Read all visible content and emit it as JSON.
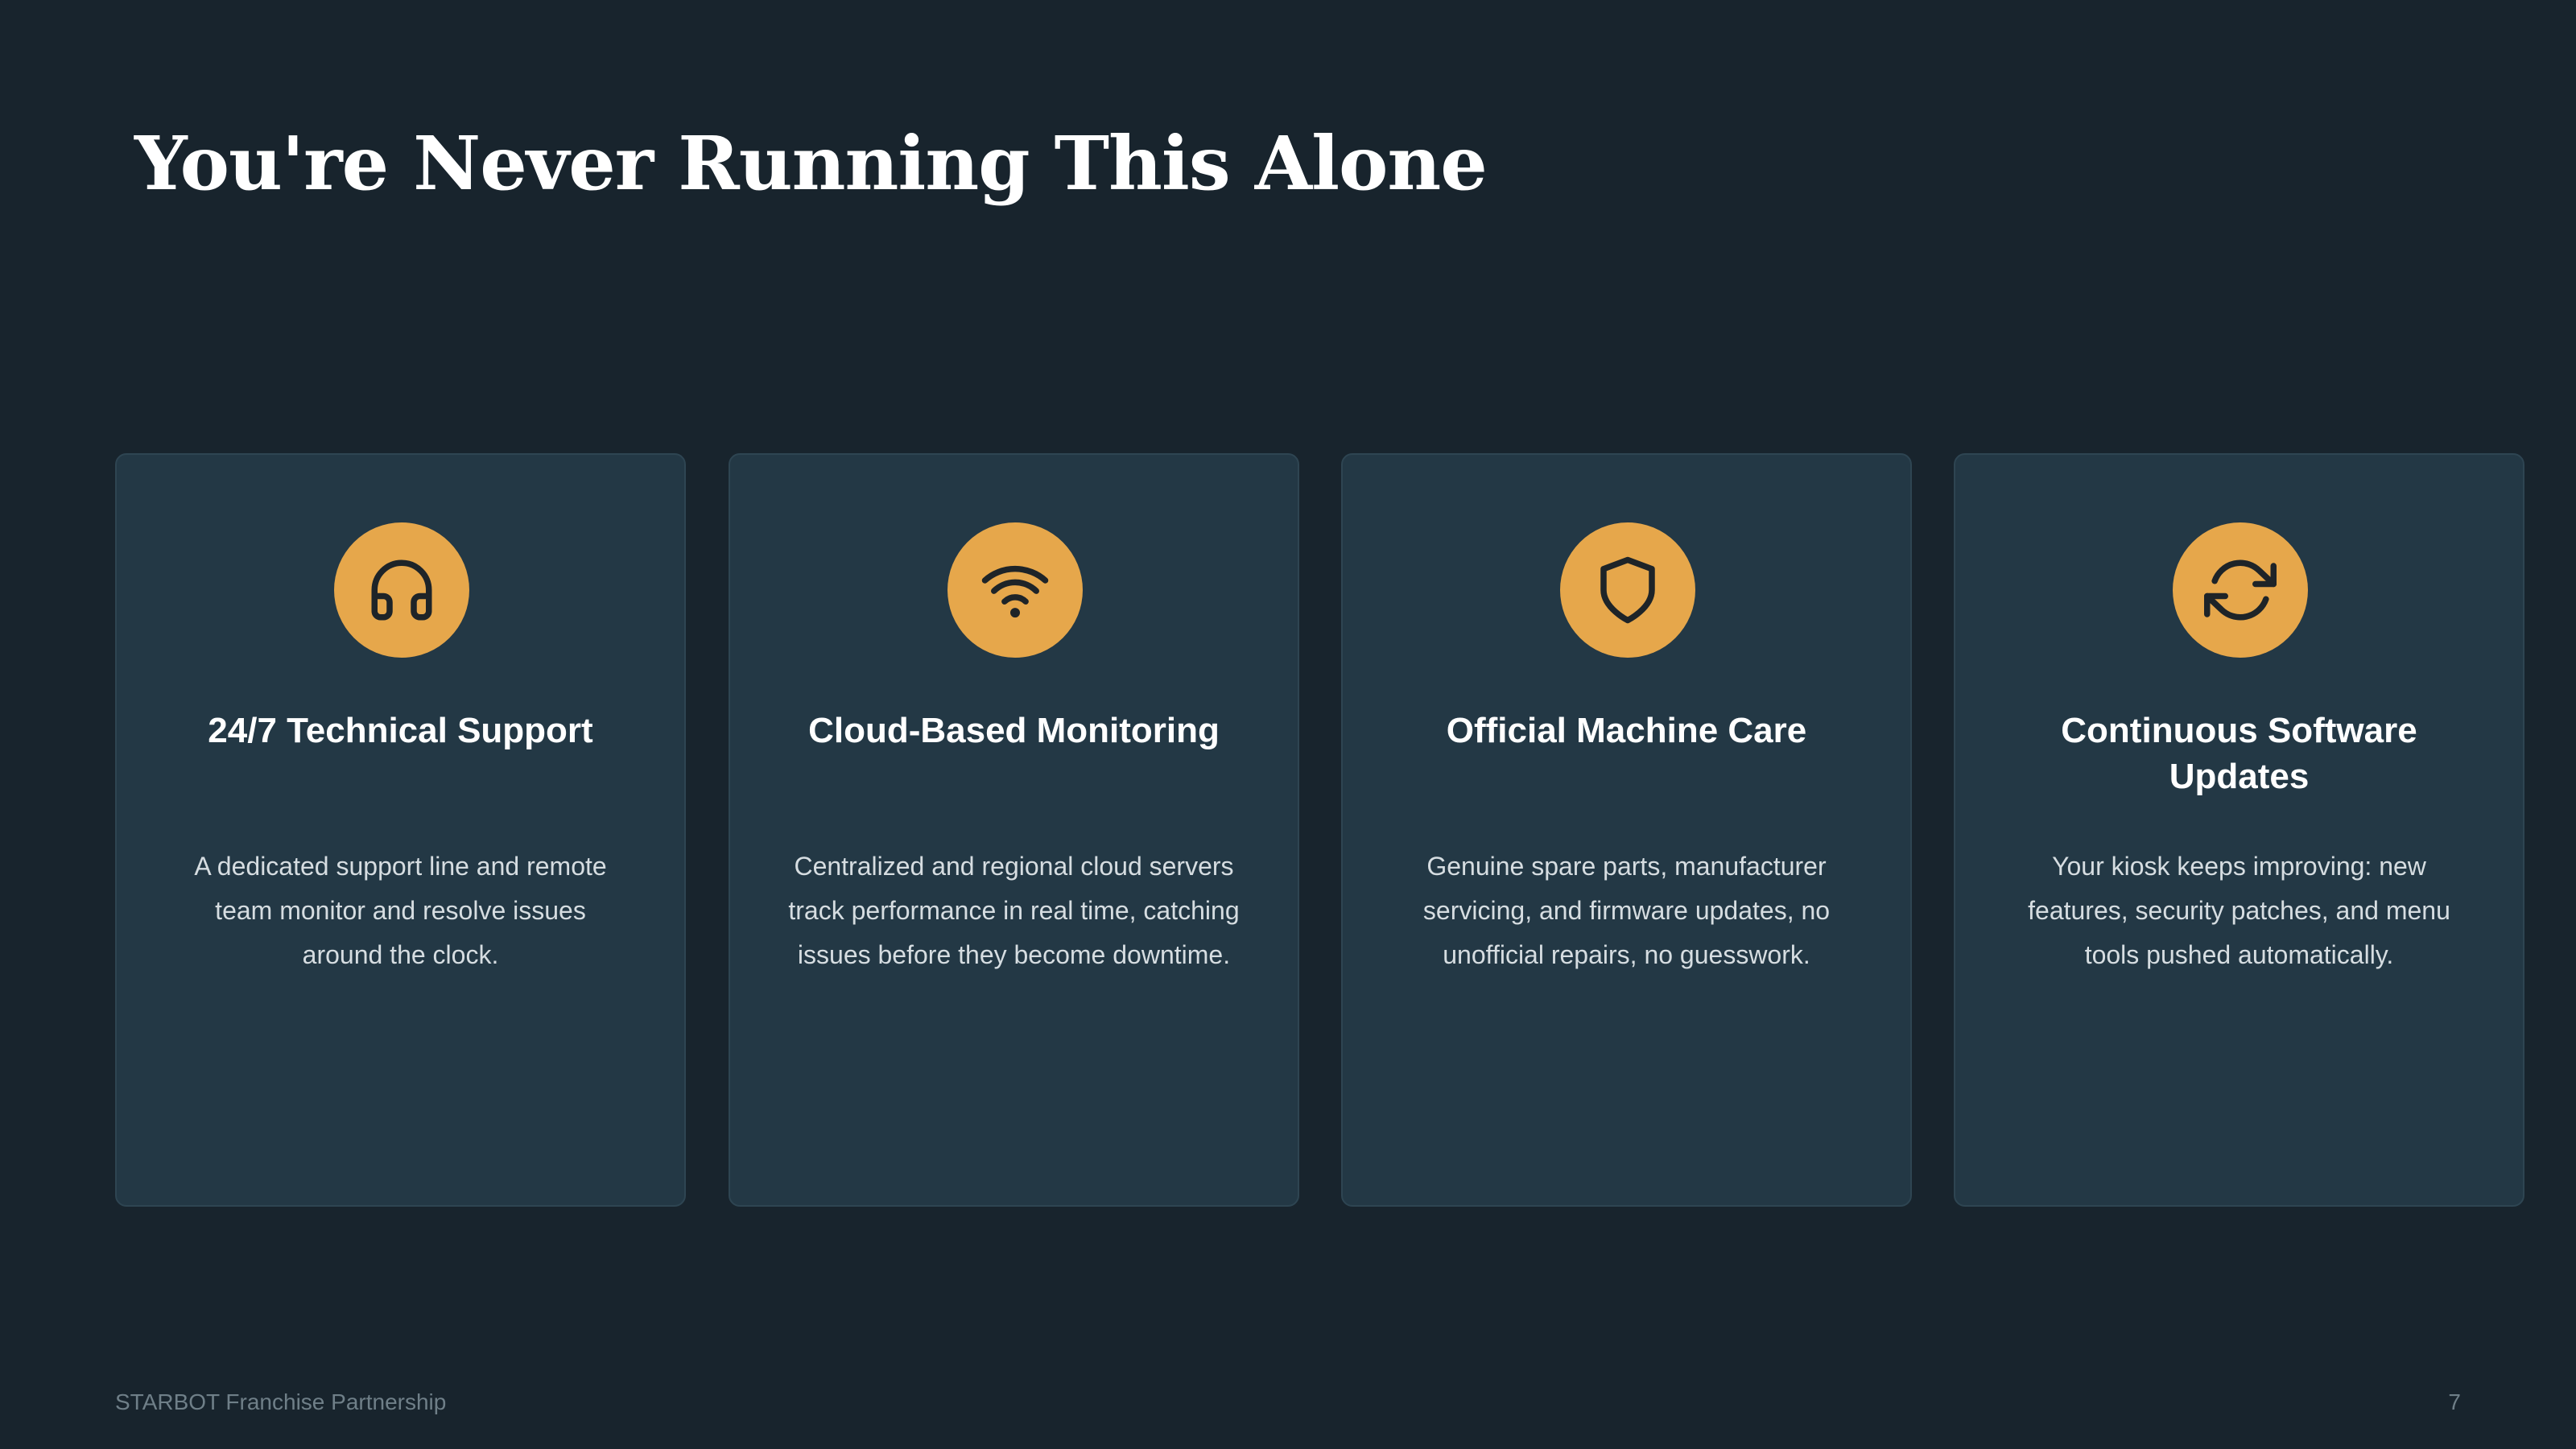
{
  "slide": {
    "title": "You're Never Running This Alone",
    "cards": [
      {
        "icon": "headphones-icon",
        "title": "24/7 Technical Support",
        "description": "A dedicated support line and remote team monitor and resolve issues around the clock."
      },
      {
        "icon": "wifi-icon",
        "title": "Cloud-Based Monitoring",
        "description": "Centralized and regional cloud servers track performance in real time, catching issues before they become downtime."
      },
      {
        "icon": "shield-icon",
        "title": "Official Machine Care",
        "description": "Genuine spare parts, manufacturer servicing, and firmware updates, no unofficial repairs, no guesswork."
      },
      {
        "icon": "refresh-icon",
        "title": "Continuous Software Updates",
        "description": "Your kiosk keeps improving: new features, security patches, and menu tools pushed automatically."
      }
    ],
    "footer": {
      "label": "STARBOT Franchise Partnership",
      "page_number": "7"
    }
  },
  "colors": {
    "background": "#18242d",
    "card": "#233845",
    "accent": "#e6a74b",
    "title_text": "#ffffff",
    "body_text": "#d6dde1"
  }
}
